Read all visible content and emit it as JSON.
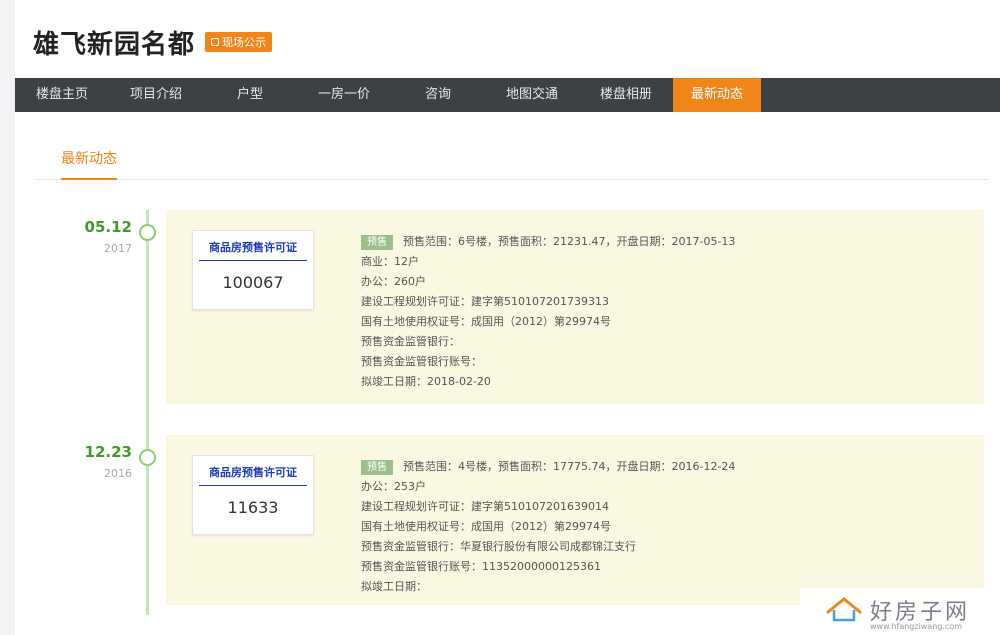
{
  "header": {
    "title": "雄飞新园名都",
    "badge": "现场公示"
  },
  "nav": {
    "items": [
      {
        "label": "楼盘主页"
      },
      {
        "label": "项目介绍"
      },
      {
        "label": "户型"
      },
      {
        "label": "一房一价"
      },
      {
        "label": "咨询"
      },
      {
        "label": "地图交通"
      },
      {
        "label": "楼盘相册"
      },
      {
        "label": "最新动态",
        "active": true
      }
    ]
  },
  "subtab": {
    "label": "最新动态"
  },
  "entries": [
    {
      "date": "05.12",
      "year": "2017",
      "cert_title": "商品房预售许可证",
      "cert_no": "100067",
      "tag": "预售",
      "lines": [
        "预售范围：6号楼，预售面积：21231.47，开盘日期：2017-05-13",
        "商业：12户",
        "办公：260户",
        "建设工程规划许可证：建字第510107201739313",
        "国有土地使用权证号：成国用（2012）第29974号",
        "预售资金监管银行：",
        "预售资金监管银行账号：",
        "拟竣工日期：2018-02-20"
      ]
    },
    {
      "date": "12.23",
      "year": "2016",
      "cert_title": "商品房预售许可证",
      "cert_no": "11633",
      "tag": "预售",
      "lines": [
        "预售范围：4号楼，预售面积：17775.74，开盘日期：2016-12-24",
        "办公：253户",
        "建设工程规划许可证：建字第510107201639014",
        "国有土地使用权证号：成国用（2012）第29974号",
        "预售资金监管银行：华夏银行股份有限公司成都锦江支行",
        "预售资金监管银行账号：11352000000125361",
        "拟竣工日期："
      ]
    }
  ],
  "watermark": {
    "text": "好房子网",
    "url": "www.hfangziwang.com"
  },
  "colors": {
    "accent": "#f08519",
    "nav_bg": "#3c4146",
    "timeline_green": "#3e9c2a",
    "panel_bg": "#fbf8e1",
    "cert_blue": "#1f3bb5"
  }
}
